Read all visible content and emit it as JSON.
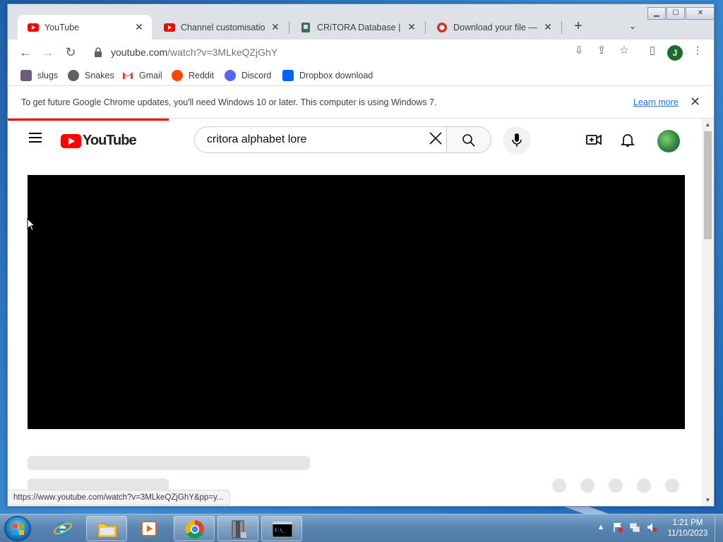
{
  "window": {
    "controls": {
      "minimize": "▁",
      "maximize": "☐",
      "close": "✕"
    }
  },
  "tabs": [
    {
      "title": "YouTube",
      "icon": "youtube-favicon",
      "active": true
    },
    {
      "title": "Channel customisation -",
      "icon": "youtube-favicon",
      "active": false
    },
    {
      "title": "CRiTORA Database | Fan",
      "icon": "critora-favicon",
      "active": false
    },
    {
      "title": "Download your file — C",
      "icon": "download-favicon",
      "active": false
    }
  ],
  "tab_close": "✕",
  "new_tab": "+",
  "tab_search": "⌄",
  "nav": {
    "back": "←",
    "forward": "→",
    "reload": "↻"
  },
  "omnibox": {
    "host": "youtube.com",
    "path": "/watch?v=3MLkeQZjGhY"
  },
  "omni_icons": {
    "install": "⇩",
    "share": "⇪",
    "star": "☆",
    "sidepanel": "▯",
    "menu": "⋮"
  },
  "profile": {
    "initial": "J",
    "color": "#1e6b2f"
  },
  "bookmarks": [
    {
      "label": "slugs",
      "icon": "slugs-icon",
      "color": "#6b5b7a"
    },
    {
      "label": "Snakes",
      "icon": "globe-icon",
      "color": "#5f6368"
    },
    {
      "label": "Gmail",
      "icon": "gmail-icon",
      "color": "#ea4335"
    },
    {
      "label": "Reddit",
      "icon": "reddit-icon",
      "color": "#ff4500"
    },
    {
      "label": "Discord",
      "icon": "discord-icon",
      "color": "#5865f2"
    },
    {
      "label": "Dropbox download",
      "icon": "dropbox-icon",
      "color": "#0061ff"
    }
  ],
  "infobar": {
    "message": "To get future Google Chrome updates, you'll need Windows 10 or later. This computer is using Windows 7.",
    "link": "Learn more",
    "close": "✕"
  },
  "youtube": {
    "logo_text": "YouTube",
    "search_value": "critora alphabet lore",
    "clear": "✕",
    "accent": "#ff0000"
  },
  "statusbar": {
    "url": "https://www.youtube.com/watch?v=3MLkeQZjGhY&pp=y..."
  },
  "taskbar": {
    "time": "1:21 PM",
    "date": "11/10/2023",
    "tray_up": "▲"
  }
}
